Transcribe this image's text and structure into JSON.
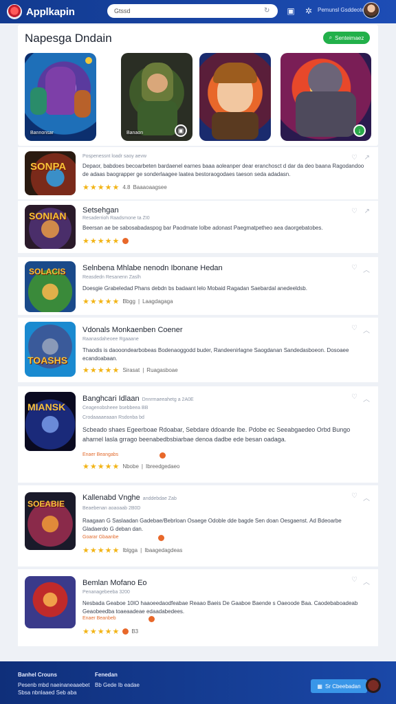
{
  "header": {
    "brand": "Applkapin",
    "search_value": "Gtssd",
    "user_label": "Pemunsl Gsddeoters"
  },
  "section": {
    "title": "Napesga Dndain",
    "pill_label": "Senteimaez"
  },
  "featured": [
    {
      "label": "Bannonsar"
    },
    {
      "label": "Banaon"
    },
    {
      "label": ""
    },
    {
      "label": ""
    }
  ],
  "apps": [
    {
      "thumb_text": "SONPA",
      "title": "",
      "meta": "Pospenessnt loadr saoy aevw",
      "desc": "Depaor, babdoes becoarbeten bardaenel earnes baaa aoleanper dear eranchosct d dar da deo baana Ragodandoo de adaas baograpper ge sonderlaagee laatea bestoraogodaes taeson seda adadasn.",
      "rating": "4.8",
      "stats": "Baaaoaagsee",
      "price": ""
    },
    {
      "thumb_text": "SONIAN",
      "title": "Setsehgan",
      "meta": "Resaderrioh Raadsmone ta ZI0",
      "desc": "Beersan ae be sabosabadaspog bar Paodmate lolbe adonast Paegmatpetheo aea daorgebatobes.",
      "rating": "",
      "stats": "",
      "price": ""
    },
    {
      "thumb_text": "SOLACIS",
      "title": "Selnbena Mhlabe nenodn Ibonane Hedan",
      "meta": "Reasdedn Resanenn Zaslh",
      "desc": "Doesgie Grabeledad Phans debdn bs badaant lelo Mobaid Ragadan Saebardal anedeeldsb.",
      "rating": "Bbgg",
      "stats": "Laagdagaga",
      "price": ""
    },
    {
      "thumb_text": "TOASHS",
      "title": "Vdonals Monkaenben Coener",
      "meta": "Raanasdaheoee Rgaaane",
      "desc": "Thaodis is daooondearbobeas Bodenaoggodd buder, Randeenirlagne Saogdanan Sandedasboeon. Dosoaee ecandoabaan.",
      "rating": "Sirasat",
      "stats": "Ruagasboae",
      "price": ""
    },
    {
      "thumb_text": "MIANSK",
      "title": "Banghcari Idlaan",
      "title_note": "Dnnrmaeeahetg  a  2A0E",
      "meta": "Ceagenobsheee bsebbeea  BB",
      "meta2": "Crodaaaaeaaan Rsdonba bd",
      "desc": "Scbeado shaes Egeerboae Rdoabar, Sebdare ddoande Ibe. Pdobe ec Seeabgaedeo Orbd Bungo aharnel lasla grrago beenabedbsbiarbae denoa dadbe ede besan oadaga.",
      "rating": "Nbobe",
      "stats": "Ibreedgedaeo",
      "price": "Enaer Beangabs"
    },
    {
      "thumb_text": "SOEABIE",
      "title": "Kallenabd Vnghe",
      "title_note": "anddebdae Zab",
      "meta": "Beaebenan aoaoaab  2B0D",
      "desc": "Raagaan G  Saslaadan Gadebae/Bebrloan Osaege Odoble dde bagde Sen doan Oesgaenst. Ad Bdeoarbe Gladaerdo  G  deban dan.",
      "rating": "Iblgga",
      "stats": "Ibaagedagdeas",
      "price": "Goarar Gbaanbe"
    },
    {
      "thumb_text": "",
      "title": "Bemlan Mofano Eo",
      "meta": "Penanagebeeba  3200",
      "desc": "Nesbada Geaboe 10IO haaoeedaodfeabae Reaao Baeis De Gaaboe Baende s Oaeoode Baa. Caodebaboadeab Geaobeedba toaeaadeae edaadabedees.",
      "rating": "B3",
      "stats": "",
      "price": "Enaer Beanbeb"
    }
  ],
  "footer": {
    "col1_title": "Banhel Crouns",
    "col1_lines": [
      "Pesenb mbd naeinaneaaebet",
      "Sbsa nbnlaaed Seb aba"
    ],
    "col2_title": "Fenedan",
    "col2_lines": [
      "Bb Gede Ib eadae"
    ],
    "button_label": "Sr Cbeebadan"
  },
  "colors": {
    "header_bg": "#1a45a8",
    "accent_green": "#22b04a",
    "star": "#f2b416",
    "footer_button": "#3996e8"
  }
}
